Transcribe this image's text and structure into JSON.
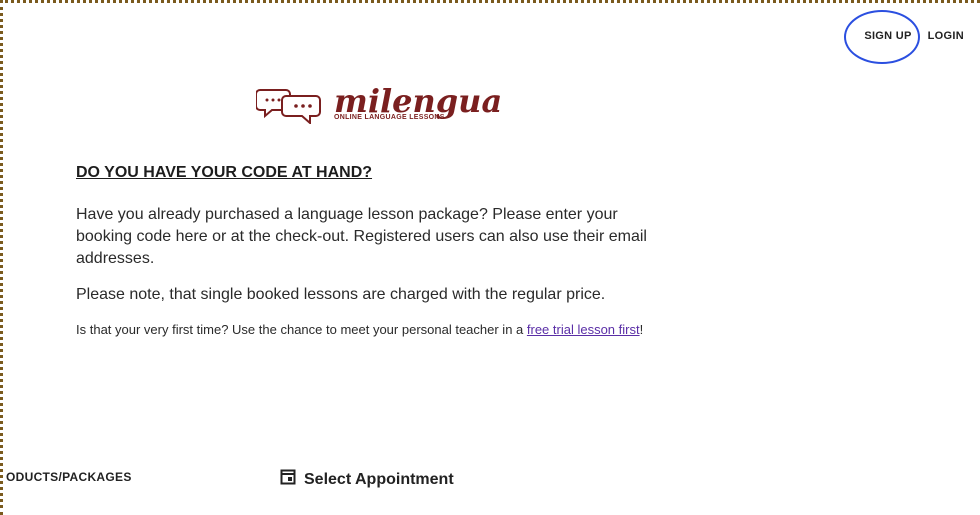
{
  "header": {
    "signup_label": "SIGN UP",
    "login_label": "LOGIN"
  },
  "logo": {
    "name": "milengua",
    "tagline": "ONLINE LANGUAGE LESSONS"
  },
  "main": {
    "heading": "DO YOU HAVE YOUR CODE AT HAND?",
    "para1": "Have you already purchased a language lesson package? Please enter your booking code here or at the check-out. Registered users can also use their email addresses.",
    "para2": "Please note, that single booked lessons are charged with the regular price.",
    "trial_prefix": "Is that your very first time? Use the chance to meet your personal teacher in a ",
    "trial_link": "free trial lesson first",
    "trial_suffix": "!"
  },
  "tabs": {
    "products_label": "ODUCTS/PACKAGES",
    "appointment_label": "Select Appointment"
  },
  "colors": {
    "brand": "#7a1f1f",
    "highlight_ring": "#2b4fe0",
    "link": "#5a2ea6"
  }
}
